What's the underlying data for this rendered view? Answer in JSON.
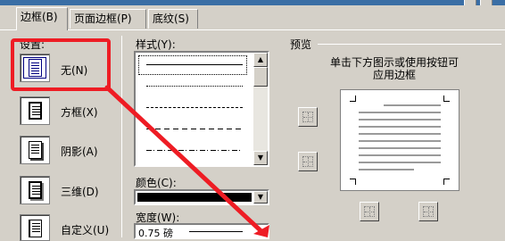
{
  "tabs": [
    {
      "label": "边框(B)",
      "active": true
    },
    {
      "label": "页面边框(P)",
      "active": false
    },
    {
      "label": "底纹(S)",
      "active": false
    }
  ],
  "setting": {
    "label": "设置:",
    "options": [
      {
        "label": "无(N)",
        "icon": "page-none-icon",
        "selected": true
      },
      {
        "label": "方框(X)",
        "icon": "page-box-icon",
        "selected": false
      },
      {
        "label": "阴影(A)",
        "icon": "page-shadow-icon",
        "selected": false
      },
      {
        "label": "三维(D)",
        "icon": "page-3d-icon",
        "selected": false
      },
      {
        "label": "自定义(U)",
        "icon": "page-custom-icon",
        "selected": false
      }
    ]
  },
  "style": {
    "label": "样式(Y):",
    "line_styles": [
      "solid",
      "dotted-fine",
      "dashed-small",
      "dashed-medium",
      "dash-dot"
    ],
    "selected_index": 0
  },
  "color": {
    "label": "颜色(C):",
    "value": "#000000"
  },
  "width": {
    "label": "宽度(W):",
    "value": "0.75 磅"
  },
  "preview": {
    "label": "预览",
    "hint_line1": "单击下方图示或使用按钮可",
    "hint_line2": "应用边框"
  },
  "colors": {
    "highlight": "#ee1c24",
    "dialog_bg": "#d4d0c8",
    "title_bar": "#3a6ea5"
  }
}
